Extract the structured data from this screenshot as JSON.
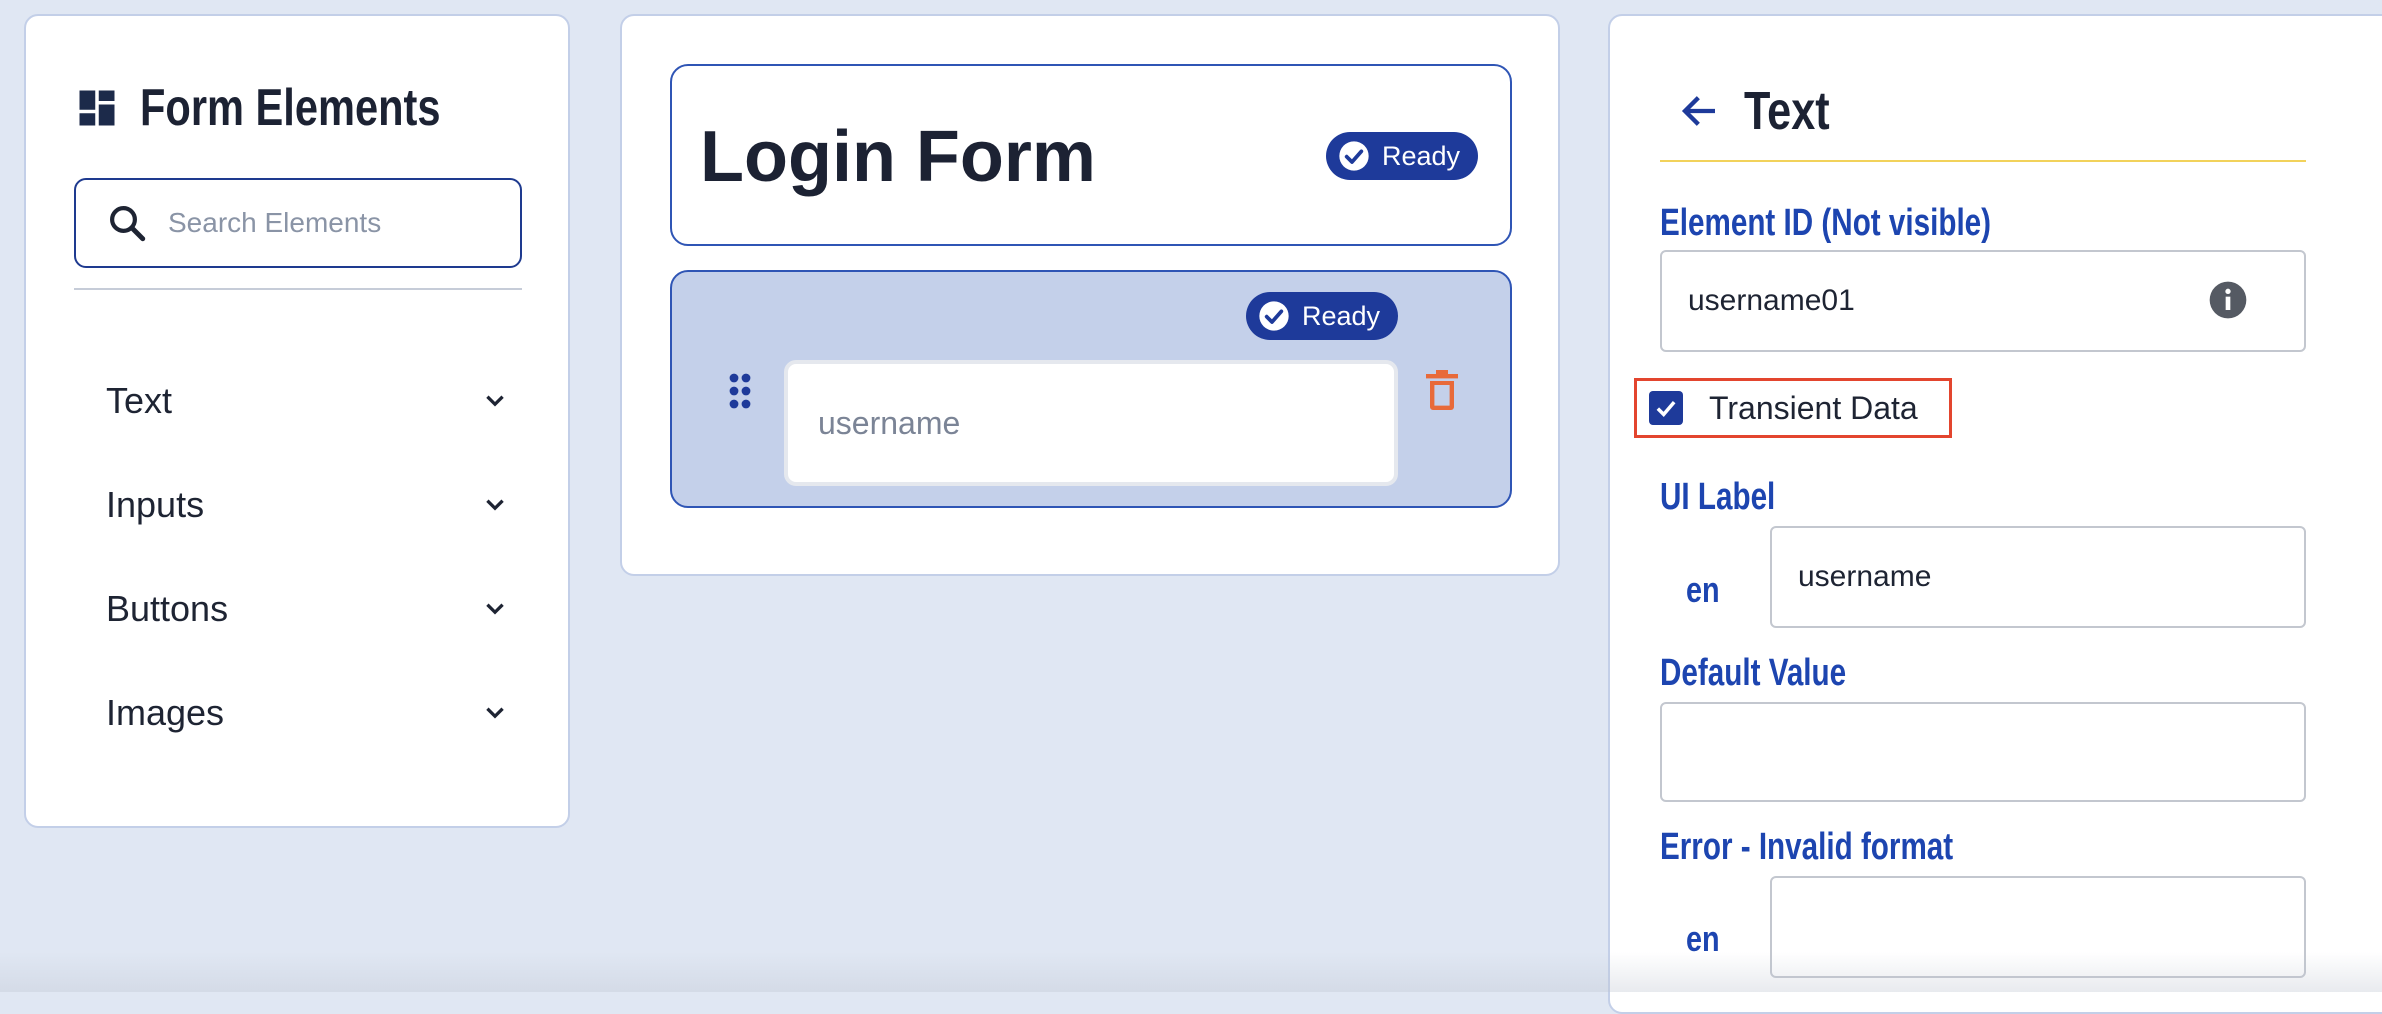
{
  "left_panel": {
    "title": "Form Elements",
    "title_icon": "dashboard-icon",
    "search": {
      "placeholder": "Search Elements",
      "value": "",
      "icon": "search-icon"
    },
    "categories": [
      {
        "label": "Text",
        "icon": "chevron-down-icon"
      },
      {
        "label": "Inputs",
        "icon": "chevron-down-icon"
      },
      {
        "label": "Buttons",
        "icon": "chevron-down-icon"
      },
      {
        "label": "Images",
        "icon": "chevron-down-icon"
      }
    ]
  },
  "middle_panel": {
    "form_title": "Login Form",
    "form_status": "Ready",
    "field": {
      "status": "Ready",
      "placeholder": "username",
      "drag_icon": "drag-handle-icon",
      "delete_icon": "trash-icon"
    }
  },
  "right_panel": {
    "title": "Text",
    "back_icon": "arrow-left-icon",
    "element_id": {
      "label": "Element ID (Not visible)",
      "value": "username01",
      "icon": "info-icon"
    },
    "transient_data": {
      "label": "Transient Data",
      "checked": true
    },
    "ui_label": {
      "label": "UI Label",
      "lang": "en",
      "value": "username"
    },
    "default_value": {
      "label": "Default Value",
      "value": ""
    },
    "error_invalid_format": {
      "label": "Error - Invalid format",
      "lang": "en",
      "value": ""
    }
  },
  "colors": {
    "background": "#e0e7f3",
    "primary": "#1e3a9a",
    "field_card": "#c4d0ea",
    "label_blue": "#1d45b0",
    "delete": "#e86a3a",
    "highlight": "#e3452e",
    "divider_yellow": "#f2d25b"
  }
}
